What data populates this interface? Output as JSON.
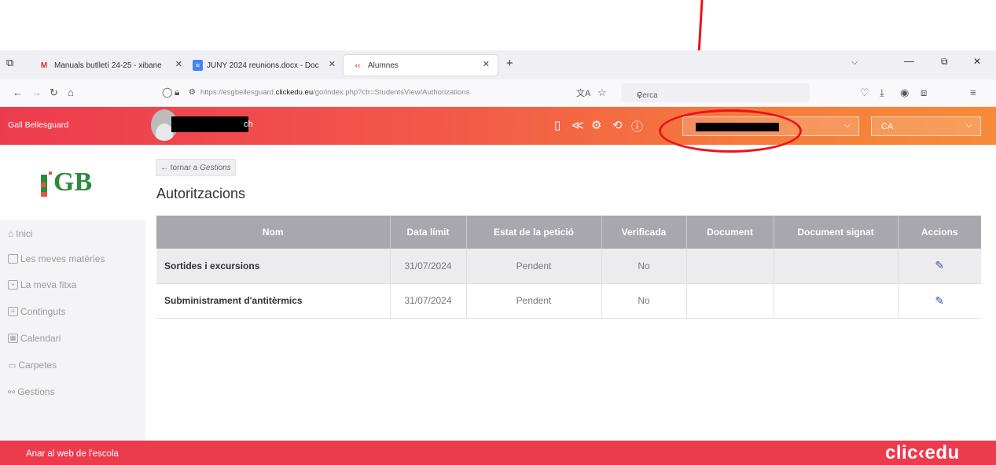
{
  "browser": {
    "tabs": [
      {
        "label": "Manuals butlletí 24-25 - xibane",
        "icon": "gmail-icon",
        "active": false
      },
      {
        "label": "JUNY 2024 reunions.docx - Doc",
        "icon": "docs-icon",
        "active": false
      },
      {
        "label": "Alumnes",
        "icon": "clickedu-icon",
        "active": true
      }
    ],
    "new_tab_label": "+",
    "url_prefix": "https://esgbellesguard.",
    "url_domain": "clickedu.eu",
    "url_path": "/go/index.php?ctr=StudentsView/Authorizations",
    "search_placeholder": "Cerca"
  },
  "header": {
    "school_name": "Gall Bellesguard",
    "user_name_tail": "ch",
    "language": "CA"
  },
  "sidebar": {
    "items": [
      {
        "label": "Inici",
        "icon": "home-icon"
      },
      {
        "label": "Les meves matèries",
        "icon": "bookmark-icon"
      },
      {
        "label": "La meva fitxa",
        "icon": "profile-card-icon"
      },
      {
        "label": "Continguts",
        "icon": "content-icon"
      },
      {
        "label": "Calendari",
        "icon": "calendar-icon"
      },
      {
        "label": "Carpetes",
        "icon": "folder-icon"
      },
      {
        "label": "Gestions",
        "icon": "gestions-icon"
      }
    ]
  },
  "main": {
    "back_label": "← tornar a",
    "back_target": "Gestions",
    "title": "Autoritzacions",
    "columns": [
      "Nom",
      "Data límit",
      "Estat de la petició",
      "Verificada",
      "Document",
      "Document signat",
      "Accions"
    ],
    "rows": [
      {
        "name": "Sortides i excursions",
        "deadline": "31/07/2024",
        "status": "Pendent",
        "verified": "No",
        "document": "",
        "signed": ""
      },
      {
        "name": "Subministrament d'antitèrmics",
        "deadline": "31/07/2024",
        "status": "Pendent",
        "verified": "No",
        "document": "",
        "signed": ""
      }
    ]
  },
  "footer": {
    "link": "Anar al web de l'escola",
    "brand": "clic‹edu"
  },
  "colors": {
    "header_start": "#ed3b4e",
    "header_end": "#f68b38",
    "footer": "#ed3b4e",
    "annotation_red": "#e8141b",
    "table_header": "#a7a7ad",
    "action_blue": "#3b52b0"
  }
}
